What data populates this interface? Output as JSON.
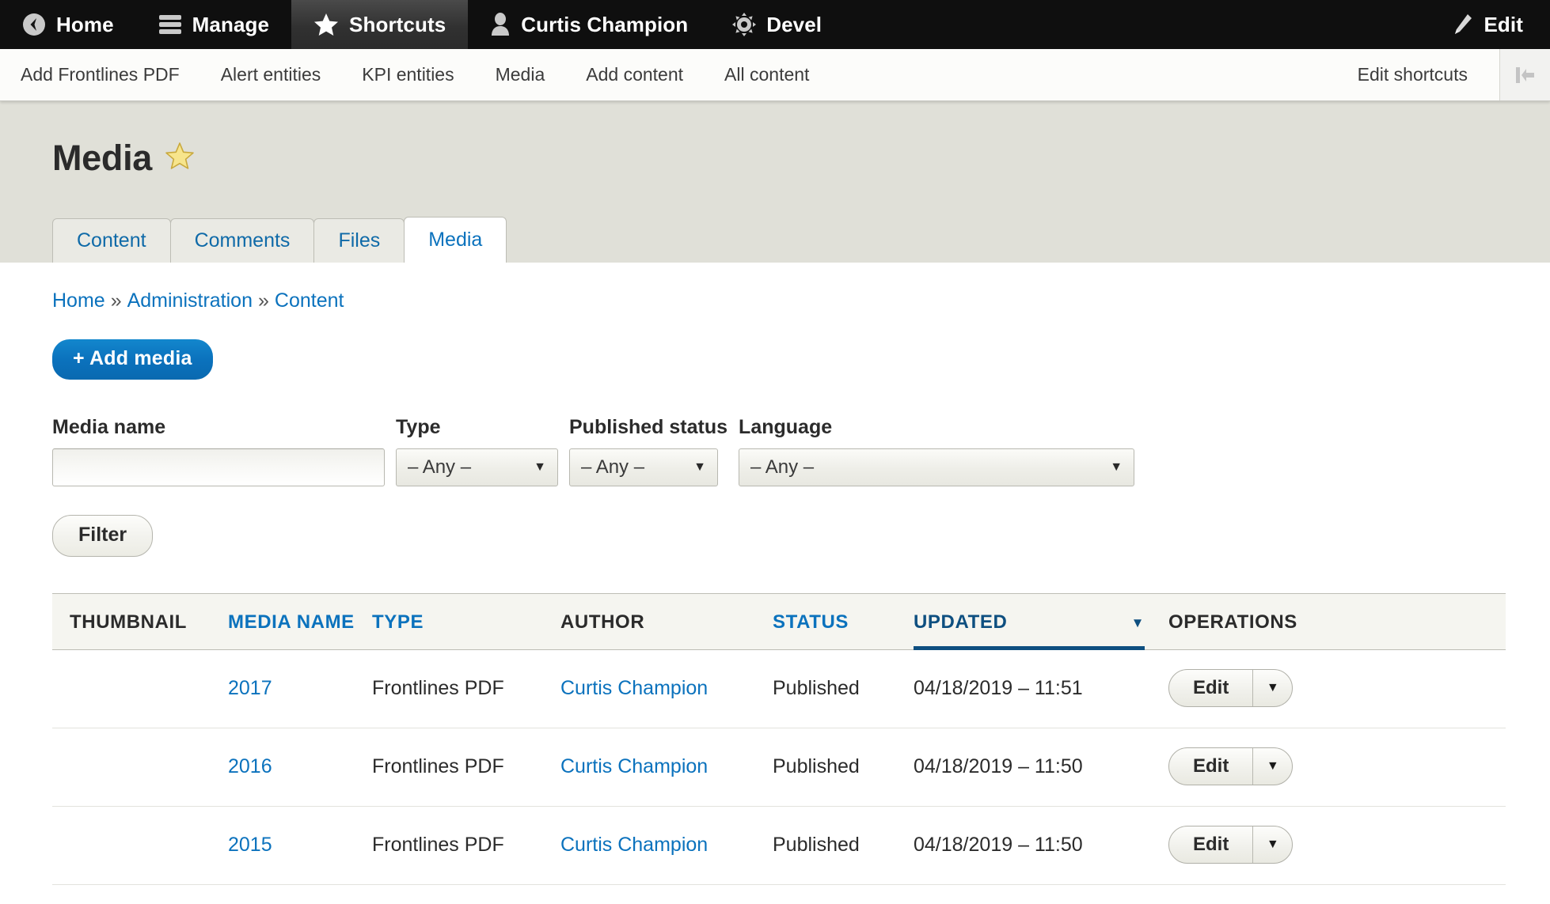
{
  "toolbar": {
    "items": [
      {
        "label": "Home",
        "icon": "home-back-icon",
        "active": false
      },
      {
        "label": "Manage",
        "icon": "hamburger-icon",
        "active": false
      },
      {
        "label": "Shortcuts",
        "icon": "star-icon",
        "active": true
      },
      {
        "label": "Curtis Champion",
        "icon": "user-icon",
        "active": false
      },
      {
        "label": "Devel",
        "icon": "gear-icon",
        "active": false
      }
    ],
    "edit_label": "Edit",
    "edit_icon": "pencil-icon"
  },
  "shortcuts": {
    "items": [
      "Add Frontlines PDF",
      "Alert entities",
      "KPI entities",
      "Media",
      "Add content",
      "All content"
    ],
    "edit_shortcuts": "Edit shortcuts",
    "collapse_icon": "collapse-toolbar-icon"
  },
  "page": {
    "title": "Media",
    "title_star_icon": "favorite-star-icon",
    "tabs": [
      {
        "label": "Content",
        "active": false
      },
      {
        "label": "Comments",
        "active": false
      },
      {
        "label": "Files",
        "active": false
      },
      {
        "label": "Media",
        "active": true
      }
    ],
    "breadcrumb": [
      {
        "label": "Home",
        "link": true
      },
      {
        "label": "Administration",
        "link": true
      },
      {
        "label": "Content",
        "link": true
      }
    ],
    "breadcrumb_separator": "»",
    "add_media_label": "+ Add media"
  },
  "filters": {
    "media_name": {
      "label": "Media name",
      "value": "",
      "placeholder": ""
    },
    "type": {
      "label": "Type",
      "value": "– Any –"
    },
    "published_status": {
      "label": "Published status",
      "value": "– Any –"
    },
    "language": {
      "label": "Language",
      "value": "– Any –"
    },
    "submit_label": "Filter"
  },
  "table": {
    "columns": [
      {
        "key": "thumbnail",
        "label": "THUMBNAIL",
        "link": false,
        "sorted": false
      },
      {
        "key": "name",
        "label": "MEDIA NAME",
        "link": true,
        "sorted": false
      },
      {
        "key": "type",
        "label": "TYPE",
        "link": true,
        "sorted": false
      },
      {
        "key": "author",
        "label": "AUTHOR",
        "link": false,
        "sorted": false
      },
      {
        "key": "status",
        "label": "STATUS",
        "link": true,
        "sorted": false
      },
      {
        "key": "updated",
        "label": "UPDATED",
        "link": true,
        "sorted": true,
        "sort_direction": "desc",
        "sort_caret": "▼"
      },
      {
        "key": "operations",
        "label": "OPERATIONS",
        "link": false,
        "sorted": false
      }
    ],
    "rows": [
      {
        "thumbnail": "",
        "name": "2017",
        "type": "Frontlines PDF",
        "author": "Curtis Champion",
        "status": "Published",
        "updated": "04/18/2019 – 11:51",
        "operations": {
          "primary": "Edit",
          "toggle_icon": "chevron-down-icon"
        }
      },
      {
        "thumbnail": "",
        "name": "2016",
        "type": "Frontlines PDF",
        "author": "Curtis Champion",
        "status": "Published",
        "updated": "04/18/2019 – 11:50",
        "operations": {
          "primary": "Edit",
          "toggle_icon": "chevron-down-icon"
        }
      },
      {
        "thumbnail": "",
        "name": "2015",
        "type": "Frontlines PDF",
        "author": "Curtis Champion",
        "status": "Published",
        "updated": "04/18/2019 – 11:50",
        "operations": {
          "primary": "Edit",
          "toggle_icon": "chevron-down-icon"
        }
      }
    ]
  },
  "colors": {
    "toolbar_bg": "#0f0f0f",
    "link_blue": "#0b72bd",
    "primary_button": "#0b72bd",
    "sorted_navy": "#0e4f80",
    "page_head_bg": "#e0e0d8",
    "star_yellow": "#f5e07a"
  }
}
